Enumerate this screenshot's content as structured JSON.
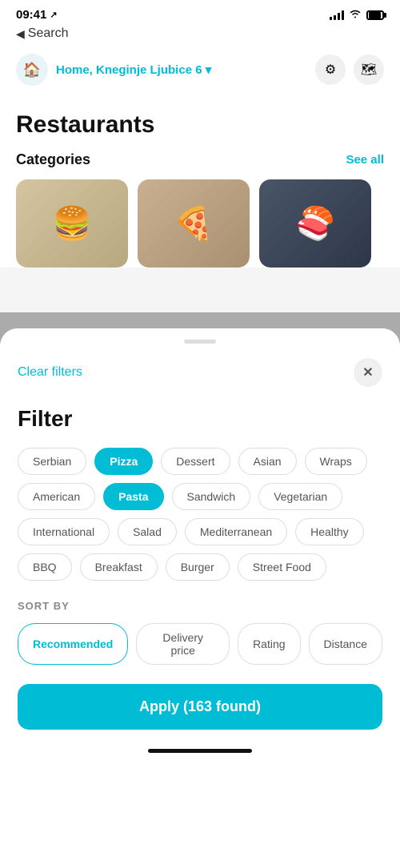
{
  "statusBar": {
    "time": "09:41",
    "locationIcon": "📍"
  },
  "navBack": {
    "label": "Search"
  },
  "locationBar": {
    "homeLabel": "Home,",
    "address": "Kneginje Ljubice 6",
    "chevron": "▾"
  },
  "mainContent": {
    "title": "Restaurants",
    "categoriesLabel": "Categories",
    "seeAllLabel": "See all"
  },
  "bottomSheet": {
    "clearFiltersLabel": "Clear filters",
    "filterTitle": "Filter",
    "tags": [
      {
        "label": "Serbian",
        "active": false
      },
      {
        "label": "Pizza",
        "active": true
      },
      {
        "label": "Dessert",
        "active": false
      },
      {
        "label": "Asian",
        "active": false
      },
      {
        "label": "Wraps",
        "active": false
      },
      {
        "label": "American",
        "active": false
      },
      {
        "label": "Pasta",
        "active": true
      },
      {
        "label": "Sandwich",
        "active": false
      },
      {
        "label": "Vegetarian",
        "active": false
      },
      {
        "label": "International",
        "active": false
      },
      {
        "label": "Salad",
        "active": false
      },
      {
        "label": "Mediterranean",
        "active": false
      },
      {
        "label": "Healthy",
        "active": false
      },
      {
        "label": "BBQ",
        "active": false
      },
      {
        "label": "Breakfast",
        "active": false
      },
      {
        "label": "Burger",
        "active": false
      },
      {
        "label": "Street Food",
        "active": false
      }
    ],
    "sortByLabel": "SORT BY",
    "sortOptions": [
      {
        "label": "Recommended",
        "active": true
      },
      {
        "label": "Delivery price",
        "active": false
      },
      {
        "label": "Rating",
        "active": false
      },
      {
        "label": "Distance",
        "active": false
      }
    ],
    "applyLabel": "Apply (163 found)"
  }
}
